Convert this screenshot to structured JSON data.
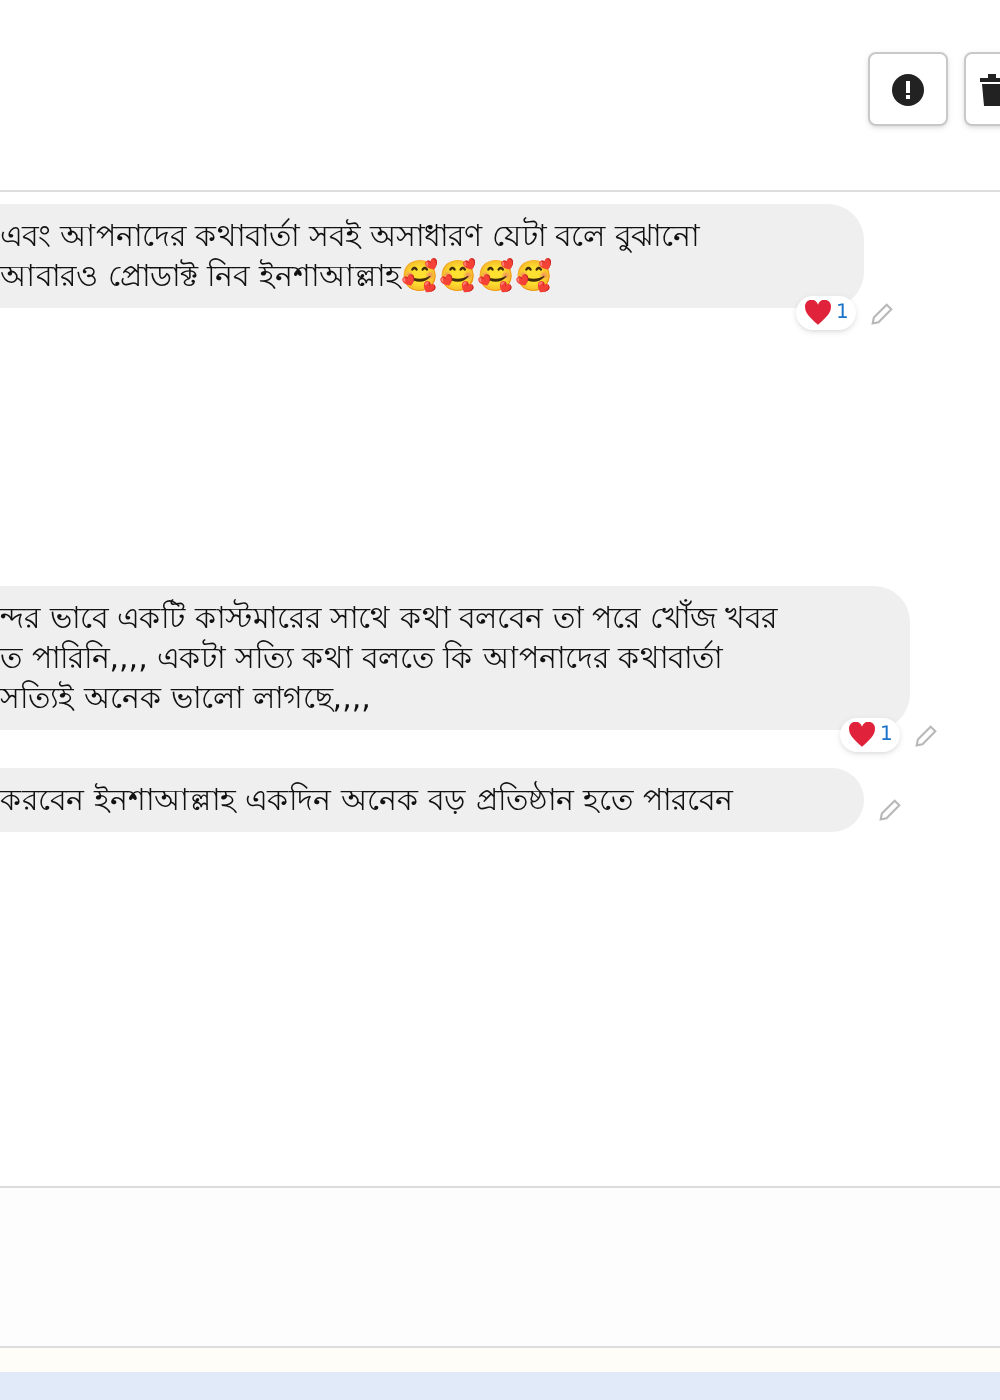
{
  "messages": [
    {
      "lines": [
        "এবং আপনাদের কথাবার্তা সবই অসাধারণ যেটা বলে বুঝানো",
        "আবারও প্রোডাক্ট নিব ইনশাআল্লাহ🥰🥰🥰🥰"
      ],
      "reaction": {
        "count": "1"
      }
    },
    {
      "lines": [
        "ন্দর ভাবে একটি কাস্টমারের সাথে কথা বলবেন তা পরে খোঁজ খবর",
        "ত পারিনি,,,, একটা সত্যি কথা বলতে কি আপনাদের কথাবার্তা",
        "সত্যিই অনেক ভালো লাগছে,,,,"
      ],
      "reaction": {
        "count": "1"
      }
    },
    {
      "lines": [
        "করবেন ইনশাআল্লাহ একদিন অনেক বড় প্রতিষ্ঠান হতে পারবেন"
      ]
    }
  ]
}
